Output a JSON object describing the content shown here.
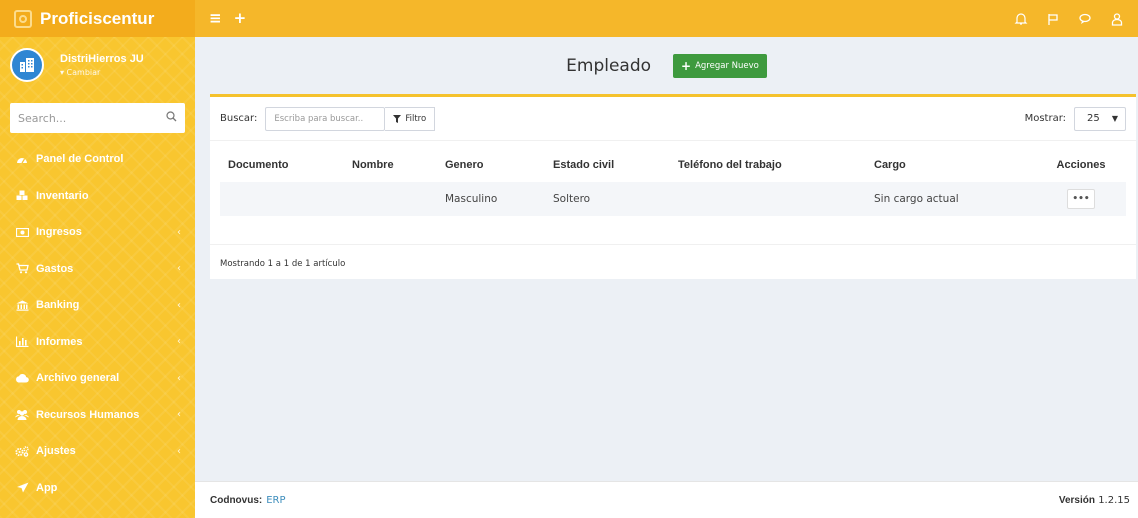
{
  "app": {
    "name": "Proficiscentur"
  },
  "topbar": {
    "left_icons": [
      "menu-icon",
      "plus-icon"
    ],
    "right_icons": [
      "bell-icon",
      "flag-icon",
      "chat-icon",
      "user-icon"
    ]
  },
  "user": {
    "company": "DistriHierros JU",
    "change_label": "▾ Cambiar"
  },
  "sidebar": {
    "search_placeholder": "Search...",
    "items": [
      {
        "label": "Panel de Control",
        "icon": "dashboard-icon",
        "has_submenu": false
      },
      {
        "label": "Inventario",
        "icon": "cubes-icon",
        "has_submenu": false
      },
      {
        "label": "Ingresos",
        "icon": "money-icon",
        "has_submenu": true
      },
      {
        "label": "Gastos",
        "icon": "cart-icon",
        "has_submenu": true
      },
      {
        "label": "Banking",
        "icon": "bank-icon",
        "has_submenu": true
      },
      {
        "label": "Informes",
        "icon": "chart-icon",
        "has_submenu": true
      },
      {
        "label": "Archivo general",
        "icon": "cloud-icon",
        "has_submenu": true
      },
      {
        "label": "Recursos Humanos",
        "icon": "users-icon",
        "has_submenu": true
      },
      {
        "label": "Ajustes",
        "icon": "cogs-icon",
        "has_submenu": true
      },
      {
        "label": "App",
        "icon": "rocket-icon",
        "has_submenu": false
      }
    ]
  },
  "page": {
    "title": "Empleado",
    "add_button": "Agregar Nuevo"
  },
  "toolbar": {
    "search_label": "Buscar:",
    "search_placeholder": "Escriba para buscar..",
    "filter_label": "Filtro",
    "show_label": "Mostrar:",
    "show_value": "25"
  },
  "table": {
    "headers": [
      "Documento",
      "Nombre",
      "Genero",
      "Estado civil",
      "Teléfono del trabajo",
      "Cargo",
      "Acciones"
    ],
    "rows": [
      {
        "documento": "",
        "nombre": "",
        "genero": "Masculino",
        "estado_civil": "Soltero",
        "telefono": "",
        "cargo": "Sin cargo actual",
        "acciones": "•••"
      }
    ]
  },
  "pagination": {
    "summary": "Mostrando 1 a 1 de 1 artículo"
  },
  "footer": {
    "brand": "Codnovus:",
    "link": "ERP",
    "version_label": "Versión",
    "version": "1.2.15"
  },
  "colors": {
    "accent": "#f5b72a",
    "sidebar": "#f9c62f",
    "add_button": "#3e9a3e",
    "link": "#3c8dbc"
  }
}
